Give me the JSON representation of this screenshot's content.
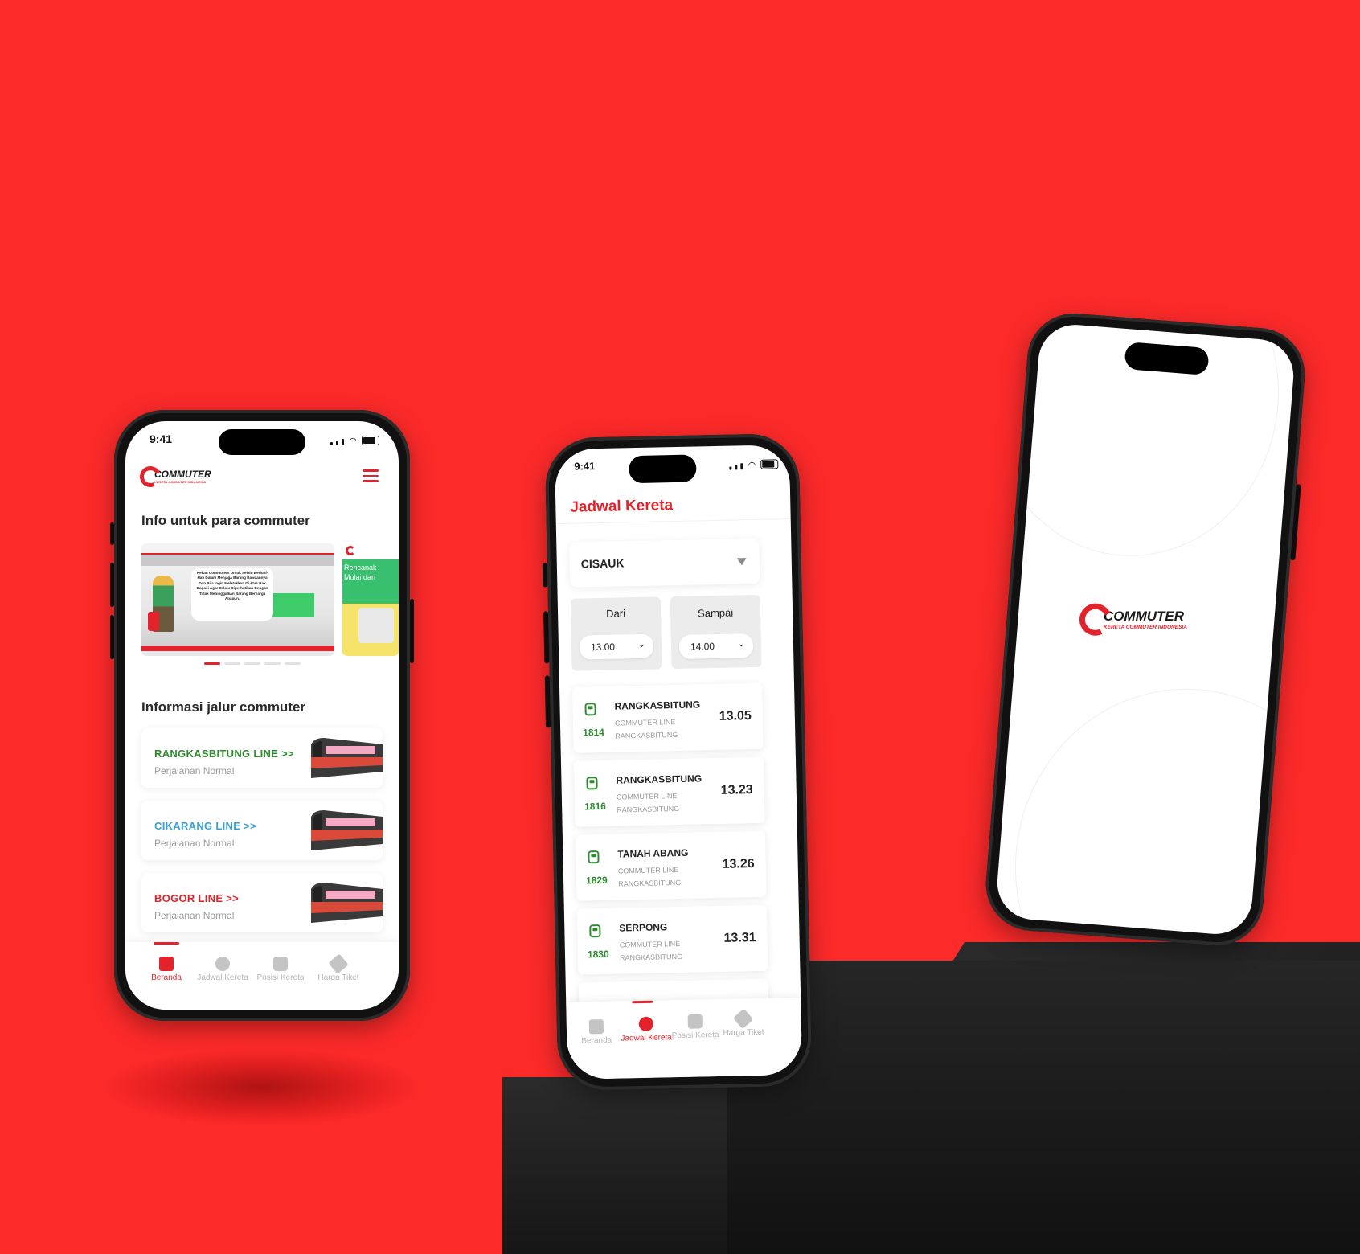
{
  "phone_home": {
    "status_time": "9:41",
    "logo": {
      "text": "COMMUTER",
      "subtext": "KERETA COMMUTER INDONESIA"
    },
    "info_heading": "Info untuk para commuter",
    "banner_text": "Rekan Commuters Untuk Selalu Berhati-Hati Dalam Menjaga Barang Bawaannya Dan Bila Ingin Meletakkan Di Atas Rak Bagasi Agar Selalu Diperhatikan Dengan Tidak Meninggalkan Barang Berharga Apapun.",
    "banner2_text": "Rencanak Mulai dari",
    "lines_heading": "Informasi jalur commuter",
    "lines": [
      {
        "name": "RANGKASBITUNG  LINE >>",
        "status": "Perjalanan Normal",
        "color": "#2e8b2e"
      },
      {
        "name": "CIKARANG LINE >>",
        "status": "Perjalanan Normal",
        "color": "#3aa0d8"
      },
      {
        "name": "BOGOR LINE >>",
        "status": "Perjalanan Normal",
        "color": "#e3232b"
      }
    ],
    "tabs": [
      {
        "label": "Beranda",
        "icon": "home-icon",
        "active": true
      },
      {
        "label": "Jadwal Kereta",
        "icon": "schedule-icon",
        "active": false
      },
      {
        "label": "Posisi Kereta",
        "icon": "train-icon",
        "active": false
      },
      {
        "label": "Harga Tiket",
        "icon": "ticket-icon",
        "active": false
      }
    ]
  },
  "phone_schedule": {
    "status_time": "9:41",
    "title": "Jadwal Kereta",
    "station": "CISAUK",
    "from_label": "Dari",
    "from_value": "13.00",
    "to_label": "Sampai",
    "to_value": "14.00",
    "schedules": [
      {
        "number": "1814",
        "destination": "RANGKASBITUNG",
        "type": "COMMUTER LINE",
        "route": "RANGKASBITUNG",
        "time": "13.05"
      },
      {
        "number": "1816",
        "destination": "RANGKASBITUNG",
        "type": "COMMUTER LINE",
        "route": "RANGKASBITUNG",
        "time": "13.23"
      },
      {
        "number": "1829",
        "destination": "TANAH ABANG",
        "type": "COMMUTER LINE",
        "route": "RANGKASBITUNG",
        "time": "13.26"
      },
      {
        "number": "1830",
        "destination": "SERPONG",
        "type": "COMMUTER LINE",
        "route": "RANGKASBITUNG",
        "time": "13.31"
      }
    ],
    "tabs": [
      {
        "label": "Beranda",
        "icon": "home-icon",
        "active": false
      },
      {
        "label": "Jadwal Kereta",
        "icon": "schedule-icon",
        "active": true
      },
      {
        "label": "Posisi Kereta",
        "icon": "train-icon",
        "active": false
      },
      {
        "label": "Harga Tiket",
        "icon": "ticket-icon",
        "active": false
      }
    ]
  },
  "phone_splash": {
    "logo": {
      "text": "COMMUTER",
      "subtext": "KERETA COMMUTER INDONESIA"
    }
  },
  "colors": {
    "background": "#fd2a2a",
    "brand_red": "#e3232b",
    "green": "#2e8b2e",
    "blue": "#3aa0d8"
  }
}
